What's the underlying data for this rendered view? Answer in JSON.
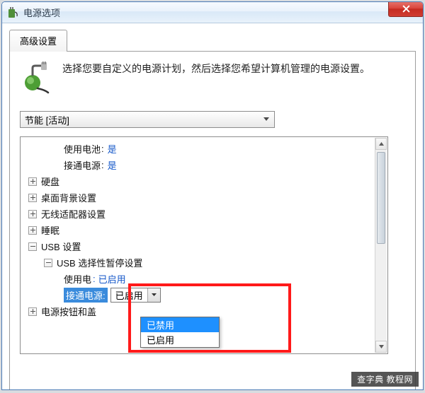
{
  "window": {
    "title": "电源选项",
    "close_icon": "close-icon"
  },
  "tab": {
    "label": "高级设置"
  },
  "description": "选择您要自定义的电源计划，然后选择您希望计算机管理的电源设置。",
  "plan_dropdown": {
    "value": "节能 [活动]"
  },
  "tree": {
    "battery_label": "使用电池",
    "ac_label": "接通电源",
    "battery_value": "是",
    "ac_value": "是",
    "items": [
      {
        "label": "硬盘",
        "exp": "plus"
      },
      {
        "label": "桌面背景设置",
        "exp": "plus"
      },
      {
        "label": "无线适配器设置",
        "exp": "plus"
      },
      {
        "label": "睡眠",
        "exp": "plus"
      },
      {
        "label": "USB 设置",
        "exp": "minus"
      },
      {
        "label": "电源按钮和盖子",
        "exp": "plus",
        "truncated": true
      }
    ],
    "usb_child": {
      "label": "USB 选择性暂停设置",
      "exp": "minus"
    },
    "usb_battery": {
      "label": "使用电池",
      "value": "已启用",
      "display": "使用电",
      "value_display": "已启用"
    },
    "usb_ac": {
      "label": "接通电源",
      "value": "已启用",
      "display": "接通电源"
    }
  },
  "dropdown": {
    "selected": "已启用",
    "options": [
      "已禁用",
      "已启用"
    ]
  },
  "watermark": "查字典  教程网",
  "truncated_label": "电源按钮和盖"
}
